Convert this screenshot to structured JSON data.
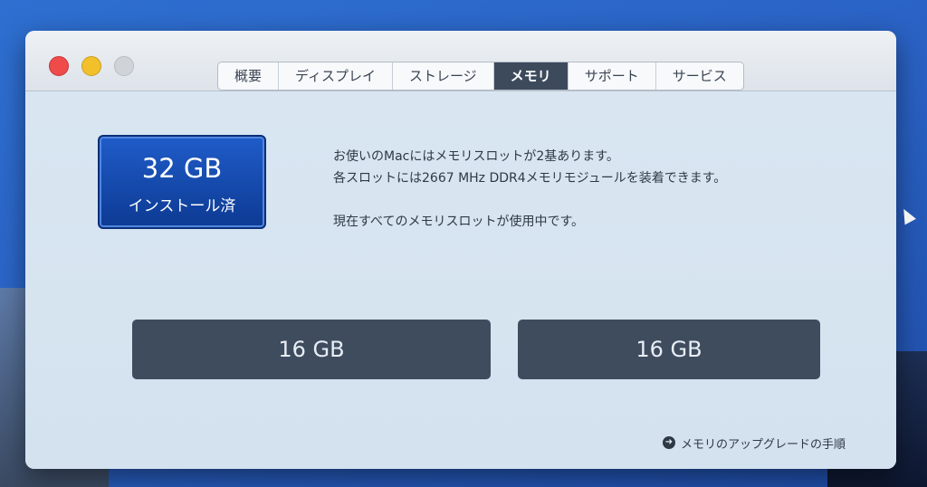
{
  "tabs": [
    {
      "label": "概要"
    },
    {
      "label": "ディスプレイ"
    },
    {
      "label": "ストレージ"
    },
    {
      "label": "メモリ",
      "active": true
    },
    {
      "label": "サポート"
    },
    {
      "label": "サービス"
    }
  ],
  "installed": {
    "amount": "32 GB",
    "label": "インストール済"
  },
  "info": {
    "line1": "お使いのMacにはメモリスロットが2基あります。",
    "line2": "各スロットには2667 MHz DDR4メモリモジュールを装着できます。",
    "line3": "現在すべてのメモリスロットが使用中です。"
  },
  "slots": [
    {
      "size": "16 GB"
    },
    {
      "size": "16 GB"
    }
  ],
  "upgrade_link": "メモリのアップグレードの手順",
  "colors": {
    "active_tab": "#3c4a5c",
    "installed_badge": "#1f5cc9",
    "slot": "#3e4c5e"
  }
}
